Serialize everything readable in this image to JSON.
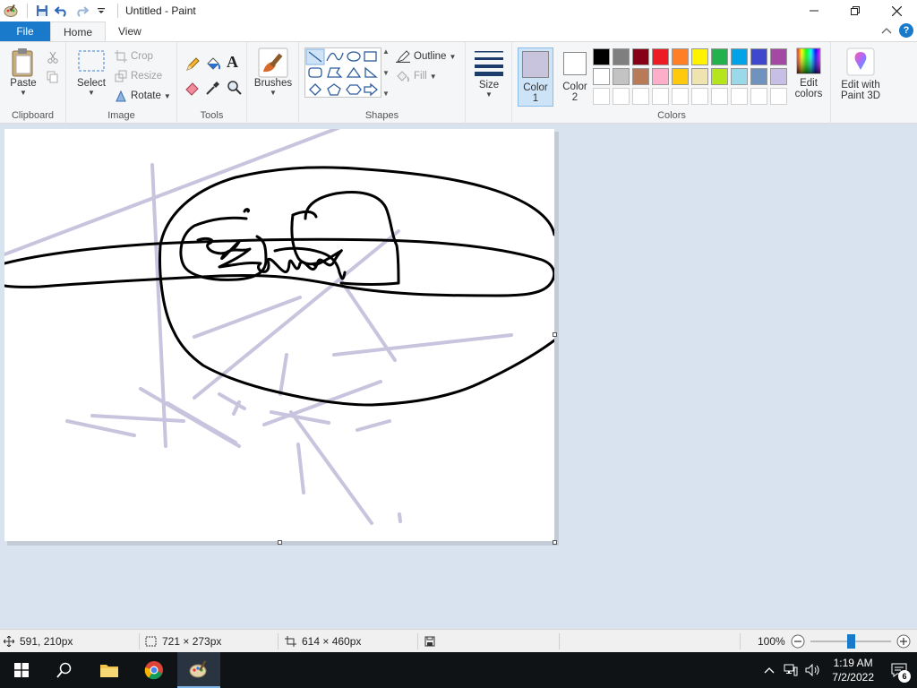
{
  "app": {
    "title": "Untitled - Paint"
  },
  "tabs": {
    "file": "File",
    "home": "Home",
    "view": "View"
  },
  "ribbon": {
    "clipboard": {
      "paste": "Paste",
      "label": "Clipboard"
    },
    "image": {
      "select": "Select",
      "crop": "Crop",
      "resize": "Resize",
      "rotate": "Rotate",
      "label": "Image"
    },
    "tools": {
      "label": "Tools"
    },
    "brushes": {
      "label": "Brushes"
    },
    "shapes": {
      "outline": "Outline",
      "fill": "Fill",
      "label": "Shapes"
    },
    "size": {
      "label": "Size"
    },
    "color1": {
      "label_top": "Color",
      "label_bottom": "1",
      "color": "#c8c4de"
    },
    "color2": {
      "label_top": "Color",
      "label_bottom": "2",
      "color": "#ffffff"
    },
    "colors": {
      "label": "Colors",
      "row1": [
        "#000000",
        "#7f7f7f",
        "#880015",
        "#ed1c24",
        "#ff7f27",
        "#fff200",
        "#22b14c",
        "#00a2e8",
        "#3f48cc",
        "#a349a4"
      ],
      "row2": [
        "#ffffff",
        "#c3c3c3",
        "#b97a57",
        "#ffaec9",
        "#ffc90e",
        "#efe4b0",
        "#b5e61d",
        "#99d9ea",
        "#7092be",
        "#c8bfe7"
      ]
    },
    "edit_colors": {
      "line1": "Edit",
      "line2": "colors"
    },
    "paint3d": {
      "line1": "Edit with",
      "line2": "Paint 3D"
    }
  },
  "status": {
    "cursor_pos": "591, 210px",
    "selection_size": "721 × 273px",
    "image_size": "614 × 460px",
    "zoom": "100%"
  },
  "taskbar": {
    "time": "1:19 AM",
    "date": "7/2/2022",
    "notification_count": "6"
  },
  "colors": {
    "accent": "#1979ca",
    "stroke_black": "#000000",
    "stroke_lavender": "#c8c4de"
  }
}
